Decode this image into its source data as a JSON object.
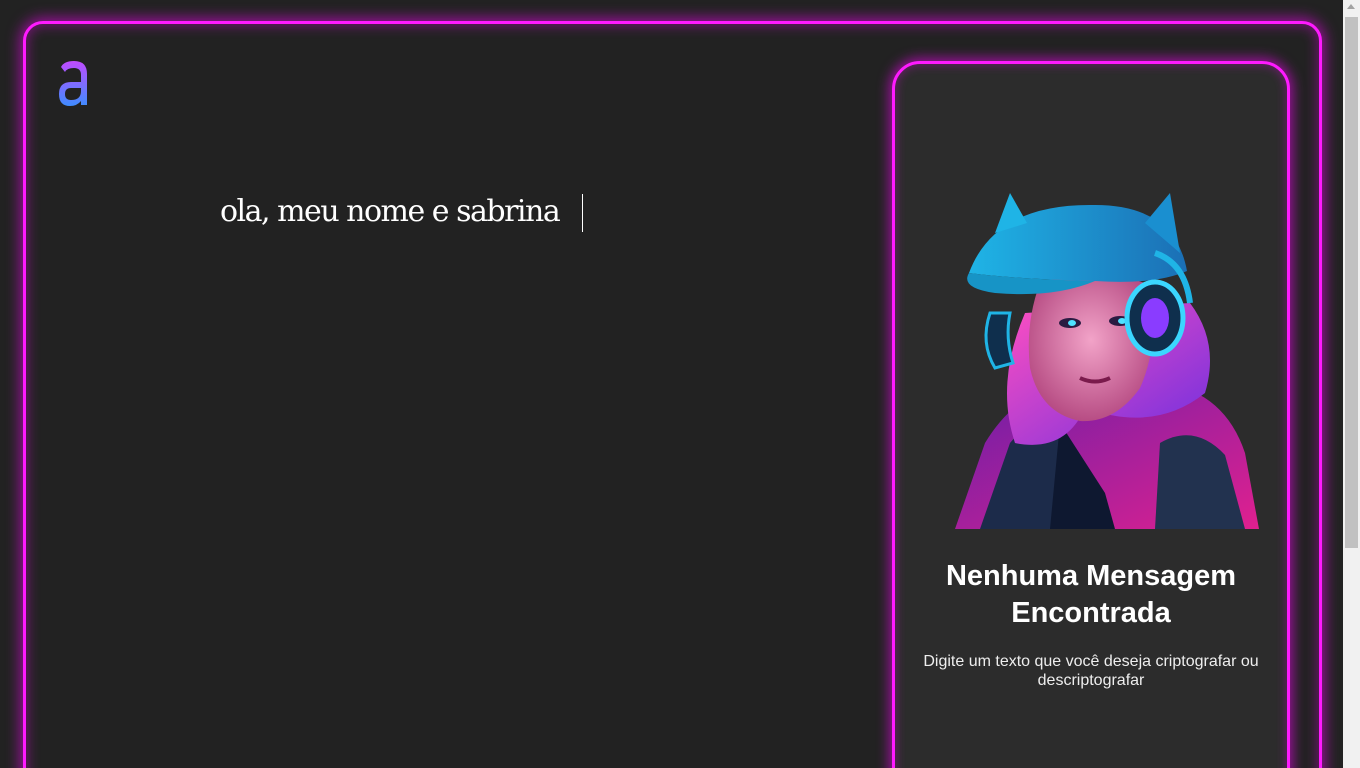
{
  "app": {
    "logo_icon": "a-letter-logo-icon",
    "accent_color": "#ff1aff",
    "background_color": "#222222"
  },
  "editor": {
    "text_value": "ola, meu nome e sabrina"
  },
  "result": {
    "illustration": "cyberpunk-girl-headphones-illustration",
    "title": "Nenhuma Mensagem Encontrada",
    "description": "Digite um texto que você deseja criptografar ou descriptografar"
  }
}
